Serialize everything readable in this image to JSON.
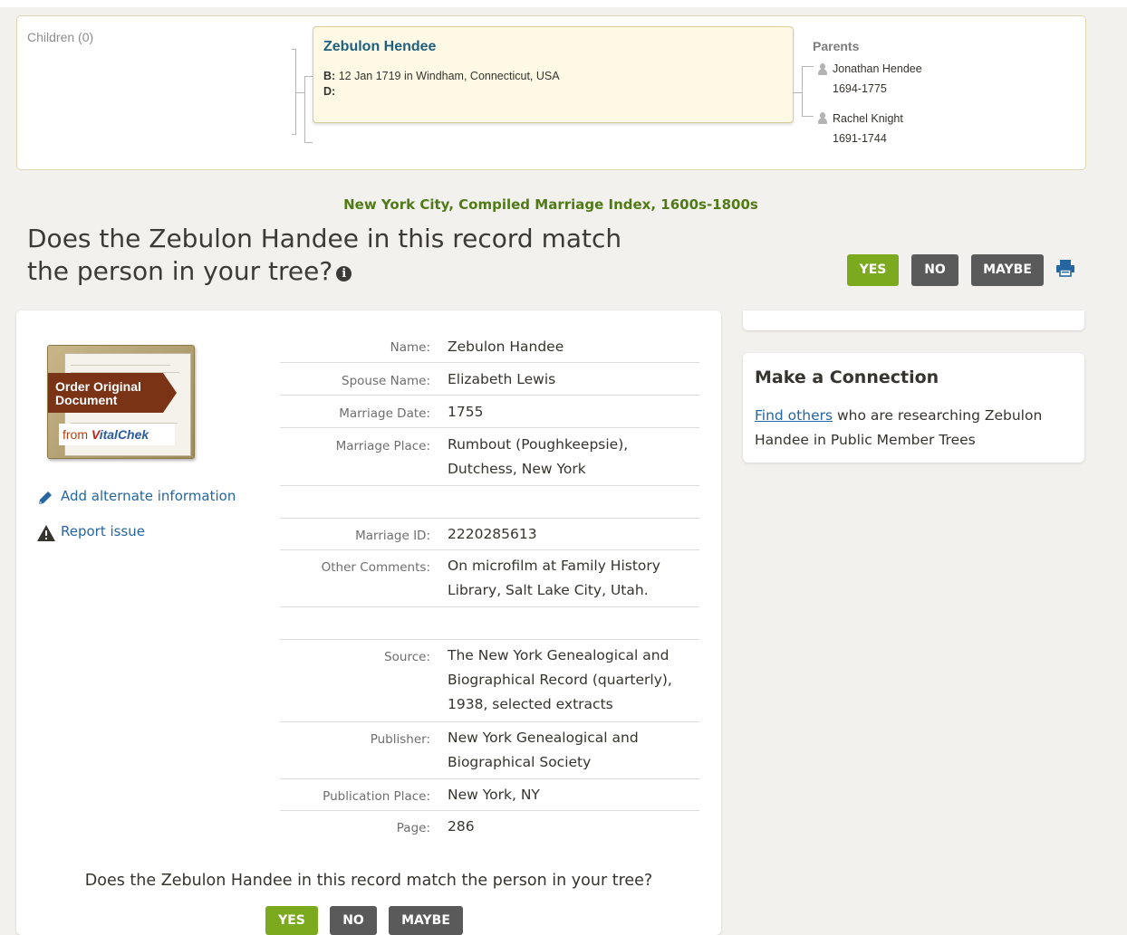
{
  "tree": {
    "children_label": "Children (0)",
    "person": {
      "name": "Zebulon Hendee",
      "birth_label": "B:",
      "birth_value": "12 Jan 1719 in Windham, Connecticut, USA",
      "death_label": "D:",
      "death_value": ""
    },
    "parents_title": "Parents",
    "parents": [
      {
        "name": "Jonathan Hendee",
        "years": "1694-1775"
      },
      {
        "name": "Rachel Knight",
        "years": "1691-1744"
      }
    ]
  },
  "collection_title": "New York City, Compiled Marriage Index, 1600s-1800s",
  "question": "Does the Zebulon Handee in this record match the person in your tree?",
  "buttons": {
    "yes": "YES",
    "no": "NO",
    "maybe": "MAYBE"
  },
  "document_promo": {
    "line1": "Order Original",
    "line2": "Document",
    "from": "from",
    "brand_v": "V",
    "brand_rest": "italChek"
  },
  "side_links": {
    "add_alternate": "Add alternate information",
    "report_issue": "Report issue"
  },
  "facts": [
    {
      "label": "Name:",
      "value": "Zebulon Handee"
    },
    {
      "label": "Spouse Name:",
      "value": "Elizabeth Lewis"
    },
    {
      "label": "Marriage Date:",
      "value": "1755"
    },
    {
      "label": "Marriage Place:",
      "value": "Rumbout (Poughkeepsie), Dutchess, New York"
    },
    {
      "label": "",
      "value": ""
    },
    {
      "label": "Marriage ID:",
      "value": "2220285613"
    },
    {
      "label": "Other Comments:",
      "value": "On microfilm at Family History Library, Salt Lake City, Utah."
    },
    {
      "label": "",
      "value": ""
    },
    {
      "label": "Source:",
      "value": "The New York Genealogical and Biographical Record (quarterly), 1938, selected extracts"
    },
    {
      "label": "Publisher:",
      "value": "New York Genealogical and Biographical Society"
    },
    {
      "label": "Publication Place:",
      "value": "New York, NY"
    },
    {
      "label": "Page:",
      "value": "286"
    }
  ],
  "bottom_question": "Does the Zebulon Handee in this record match the person in your tree?",
  "connection": {
    "title": "Make a Connection",
    "link_text": "Find others",
    "rest_text": " who are researching Zebulon Handee in Public Member Trees"
  },
  "colors": {
    "accent_green": "#7caa1e",
    "link_blue": "#2566a0",
    "dark_button": "#5a5a5a"
  },
  "icons": [
    "info-icon",
    "print-icon",
    "pencil-icon",
    "warning-icon",
    "person-icon"
  ]
}
